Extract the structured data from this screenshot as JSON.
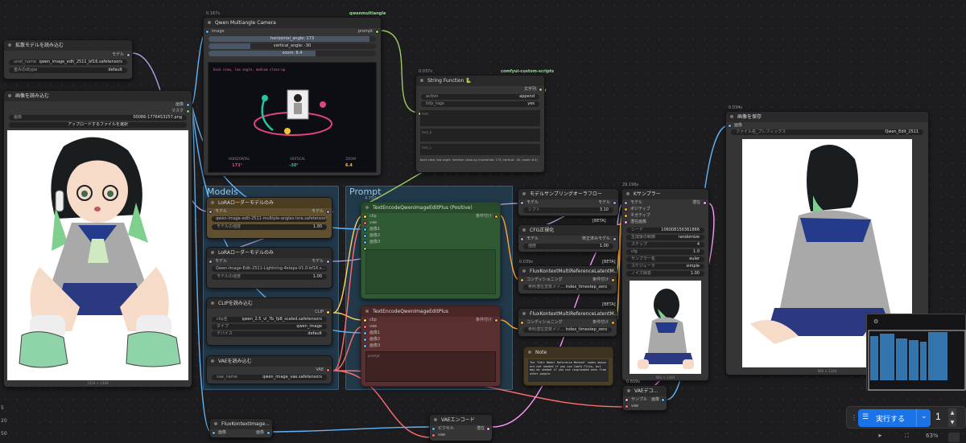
{
  "colors": {
    "wire_model": "#b39ddb",
    "wire_clip": "#ffd45c",
    "wire_vae": "#ff6e6e",
    "wire_image": "#64b5f6",
    "wire_latent": "#ff9cf9",
    "wire_cond": "#ffa931",
    "accent": "#1a73e8"
  },
  "groups": {
    "models": "Models",
    "prompt": "Prompt"
  },
  "unet": {
    "title": "拡散モデルを読み込む",
    "out": "モデル",
    "name_label": "unet_name",
    "name_val": "qwen_image_edit_2511_bf16.safetensors",
    "dtype_label": "重みのdtype",
    "dtype_val": "default"
  },
  "load_image": {
    "title": "画像を読み込む",
    "out1": "画像",
    "out2": "マスク",
    "img_label": "画像",
    "img_val": "00086-1776453257.png",
    "upload": "アップロードするファイルを選択",
    "footer": "1024 × 1408"
  },
  "camera": {
    "badge": "0.167s",
    "tag": "qwenmultiangle",
    "title": "Qwen Multiangle Camera",
    "in": "image",
    "out": "prompt",
    "h": "horizontal_angle: 173",
    "v": "vertical_angle: -30",
    "z": "zoom: 6.4",
    "caption": "back view, low angle, medium close-up",
    "l1": "HORIZONTAL",
    "l2": "VERTICAL",
    "l3": "ZOOM",
    "v1": "173°",
    "v2": "-30°",
    "v3": "6.4"
  },
  "string": {
    "badge": "0.037s",
    "tag": "comfyui-custom-scripts",
    "title": "String Function 🐍",
    "out": "文字列",
    "action_l": "action",
    "action_v": "append",
    "tidy_l": "tidy_tags",
    "tidy_v": "yes",
    "in": "text",
    "ph1": "text",
    "ph2": "text_b",
    "ph3": "text_c",
    "result": "back view, low angle, medium close-up (horizontal: 173, vertical: -30, zoom: 6.4)"
  },
  "lora1": {
    "title": "LoRAローダーモデルのみ",
    "in": "モデル",
    "out": "モデル",
    "name": "qwen-image-edit-2511-multiple-angles-lora.safetensors",
    "str_l": "モデルの強度",
    "str_v": "1.00"
  },
  "lora2": {
    "title": "LoRAローダーモデルのみ",
    "in": "モデル",
    "out": "モデル",
    "name": "Qwen-Image-Edit-2511-Lightning-4steps-V1.0-bf16.s...",
    "str_l": "モデルの強度",
    "str_v": "1.00"
  },
  "clip": {
    "title": "CLIPを読み込む",
    "out": "CLIP",
    "name_l": "clip名",
    "name_v": "qwen_2.5_vl_7b_fp8_scaled.safetensors",
    "type_l": "タイプ",
    "type_v": "qwen_image",
    "dev_l": "デバイス",
    "dev_v": "default"
  },
  "vae": {
    "title": "VAEを読み込む",
    "out": "VAE",
    "name_l": "vae_name",
    "name_v": "qwen_image_vae.safetensors"
  },
  "pos": {
    "badge": "4.752s",
    "title": "TextEncodeQwenImageEditPlus (Positive)",
    "in": [
      "clip",
      "vae",
      "画像1",
      "画像2",
      "画像3"
    ],
    "out": "条件付け"
  },
  "neg": {
    "title": "TextEncodeQwenImageEditPlus",
    "in": [
      "clip",
      "vae",
      "画像1",
      "画像2",
      "画像3"
    ],
    "out": "条件付け",
    "ph": "prompt"
  },
  "sampling": {
    "title": "モデルサンプリングオーラフロー",
    "in": "モデル",
    "out": "モデル",
    "shift_l": "シフト",
    "shift_v": "3.10",
    "beta": "[BETA]"
  },
  "cfg": {
    "title": "CFG正規化",
    "in": "モデル",
    "out": "修正済みモデル",
    "str_l": "強度",
    "str_v": "1.00"
  },
  "flux1": {
    "badge": "0.039s",
    "beta": "[BETA]",
    "title": "FluxKontextMultiReferenceLatentM...",
    "in": "コンディショニング",
    "out": "条件付け",
    "m_l": "参照潜在変数メソ...",
    "m_v": "index_timestep_zero"
  },
  "flux2": {
    "beta": "[BETA]",
    "title": "FluxKontextMultiReferenceLatentM...",
    "in": "コンディショニング",
    "out": "条件付け",
    "m_l": "参照潜在変数メソ...",
    "m_v": "index_timestep_zero"
  },
  "ksampler": {
    "badge": "29.196s",
    "title": "Kサンプラー",
    "in": [
      "モデル",
      "ポジティブ",
      "ネガティブ",
      "潜在画像"
    ],
    "out": "潜在",
    "rows": [
      {
        "l": "シード",
        "v": "106008156361866"
      },
      {
        "l": "生成後の制御",
        "v": "randomize"
      },
      {
        "l": "ステップ",
        "v": "4"
      },
      {
        "l": "cfg",
        "v": "1.0"
      },
      {
        "l": "サンプラー名",
        "v": "euler"
      },
      {
        "l": "スケジューラ",
        "v": "simple"
      },
      {
        "l": "ノイズ除去",
        "v": "1.00"
      }
    ],
    "footer": "981 × 1344"
  },
  "note": {
    "title": "Note",
    "text": "The \"Edit Model Reference Method\" nodes above are not needed if you use Comfy Files, but may be needed if you use reuploaded ones from other people."
  },
  "vaedec": {
    "badge": "0.609s",
    "title": "VAEデコ...",
    "in1": "サンプル",
    "in2": "vae",
    "out": "画像"
  },
  "save": {
    "badge": "0.034s",
    "title": "画像を保存",
    "in": "画像",
    "prefix_l": "ファイル名_プレフィックス",
    "prefix_v": "Qwen_Edit_2511",
    "footer": "980 × 1344"
  },
  "fluxctx": {
    "title": "FluxKontextImage...",
    "in": "画像",
    "out": "画像"
  },
  "vaeenc": {
    "title": "VAEエンコード",
    "in1": "ピクセル",
    "in2": "vae",
    "out": "潜在"
  },
  "bottom": {
    "run": "実行する",
    "count": "1",
    "zoom": "63%",
    "side1": "5",
    "side2": "20",
    "side3": "50"
  }
}
